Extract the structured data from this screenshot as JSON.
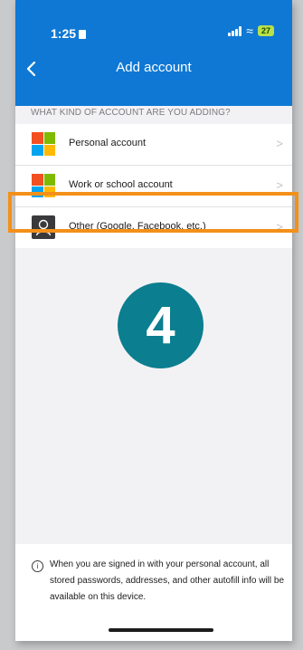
{
  "status_bar": {
    "time": "1:25",
    "battery": "27"
  },
  "header": {
    "title": "Add account"
  },
  "section_label": "WHAT KIND OF ACCOUNT ARE YOU ADDING?",
  "accounts": [
    {
      "label": "Personal account",
      "icon": "microsoft-logo-icon"
    },
    {
      "label": "Work or school account",
      "icon": "microsoft-logo-icon"
    },
    {
      "label": "Other (Google, Facebook, etc.)",
      "icon": "person-icon"
    }
  ],
  "step_badge": "4",
  "footer": {
    "info": "When you are signed in with your personal account, all stored passwords, addresses, and other autofill info will be available on this device."
  },
  "colors": {
    "header": "#0f78d4",
    "highlight": "#f39019",
    "badge": "#0b7e8f",
    "ms_red": "#f25022",
    "ms_green": "#7fba00",
    "ms_blue": "#00a4ef",
    "ms_yellow": "#ffb900"
  }
}
